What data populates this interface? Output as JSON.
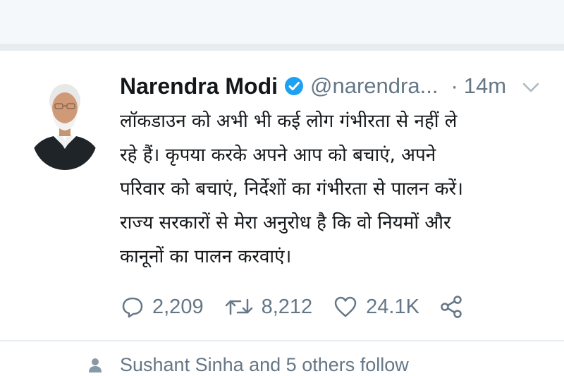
{
  "tweet": {
    "author_name": "Narendra Modi",
    "verified_icon": "verified-badge-icon",
    "handle": "@narendra...",
    "separator": "·",
    "time": "14m",
    "menu_icon": "chevron-down-icon",
    "text_lines": [
      "लॉकडाउन को अभी भी कई लोग गंभीरता से नहीं ले",
      "रहे हैं। कृपया करके अपने आप को बचाएं, अपने",
      "परिवार को बचाएं, निर्देशों का गंभीरता से पालन करें।",
      "राज्य सरकारों से मेरा अनुरोध है कि वो नियमों और",
      "कानूनों का पालन करवाएं।"
    ],
    "actions": {
      "reply_count": "2,209",
      "retweet_count": "8,212",
      "like_count": "24.1K"
    },
    "colors": {
      "text": "#14171a",
      "muted": "#657786",
      "verified": "#1da1f2"
    }
  },
  "next_item": {
    "text": "Sushant Sinha and 5 others follow"
  }
}
